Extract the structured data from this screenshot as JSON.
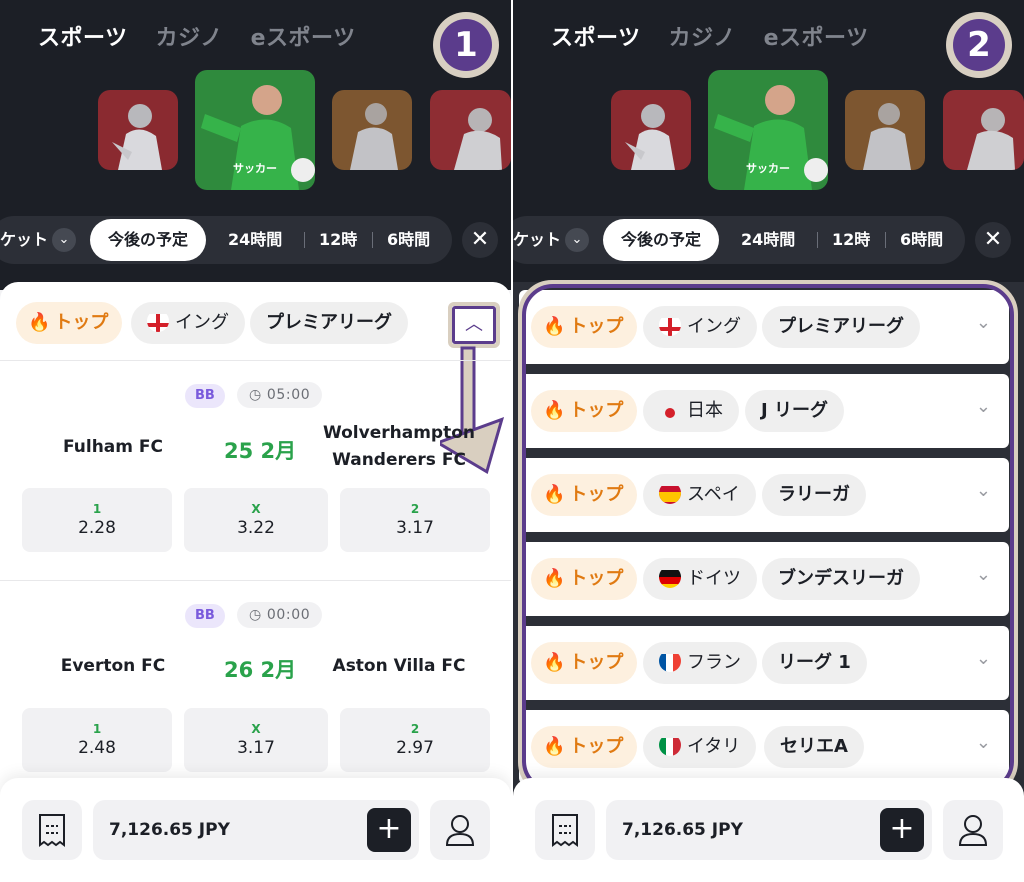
{
  "tabs": [
    "スポーツ",
    "カジノ",
    "eスポーツ"
  ],
  "steps": [
    "1",
    "2"
  ],
  "thumb_caption": "サッカー",
  "filters": {
    "prev_label": "ケット",
    "active": "今後の予定",
    "options": [
      "24時間",
      "12時",
      "6時間"
    ],
    "close": "✕"
  },
  "panel1": {
    "chips": {
      "top": "トップ",
      "country": "イング",
      "league": "プレミアリーグ"
    },
    "matches": [
      {
        "badge": "BB",
        "time": "05:00",
        "home": "Fulham FC",
        "away": "Wolverhampton Wanderers FC",
        "date": "25 2月",
        "odds": [
          {
            "label": "1",
            "value": "2.28"
          },
          {
            "label": "X",
            "value": "3.22"
          },
          {
            "label": "2",
            "value": "3.17"
          }
        ]
      },
      {
        "badge": "BB",
        "time": "00:00",
        "home": "Everton FC",
        "away": "Aston Villa FC",
        "date": "26 2月",
        "odds": [
          {
            "label": "1",
            "value": "2.48"
          },
          {
            "label": "X",
            "value": "3.17"
          },
          {
            "label": "2",
            "value": "2.97"
          }
        ]
      }
    ]
  },
  "panel2": {
    "leagues": [
      {
        "top": "トップ",
        "country": "イング",
        "league": "プレミアリーグ",
        "flag": "england"
      },
      {
        "top": "トップ",
        "country": "日本",
        "league": "J リーグ",
        "flag": "japan"
      },
      {
        "top": "トップ",
        "country": "スペイ",
        "league": "ラリーガ",
        "flag": "spain"
      },
      {
        "top": "トップ",
        "country": "ドイツ",
        "league": "ブンデスリーガ",
        "flag": "germany"
      },
      {
        "top": "トップ",
        "country": "フラン",
        "league": "リーグ 1",
        "flag": "france"
      },
      {
        "top": "トップ",
        "country": "イタリ",
        "league": "セリエA",
        "flag": "italy"
      }
    ]
  },
  "footer": {
    "balance": "7,126.65 JPY",
    "plus": "+"
  },
  "colors": {
    "dark_bg": "#1c1f26",
    "accent_green": "#2aa24b",
    "top_orange": "#e07a12",
    "highlight_purple": "#5b3c8c",
    "highlight_beige": "#d9cfc0"
  }
}
